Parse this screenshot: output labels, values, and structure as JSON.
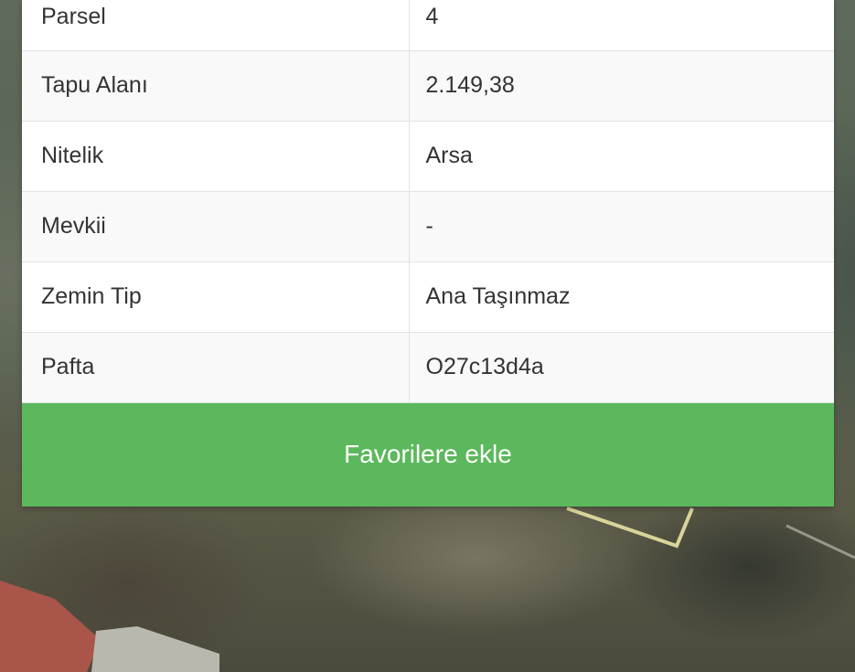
{
  "parcel_info": {
    "rows": [
      {
        "label": "Parsel",
        "value": "4"
      },
      {
        "label": "Tapu Alanı",
        "value": "2.149,38"
      },
      {
        "label": "Nitelik",
        "value": "Arsa"
      },
      {
        "label": "Mevkii",
        "value": "-"
      },
      {
        "label": "Zemin Tip",
        "value": "Ana Taşınmaz"
      },
      {
        "label": "Pafta",
        "value": "O27c13d4a"
      }
    ],
    "favorite_button_label": "Favorilere ekle",
    "accent_color": "#5cb85c"
  }
}
